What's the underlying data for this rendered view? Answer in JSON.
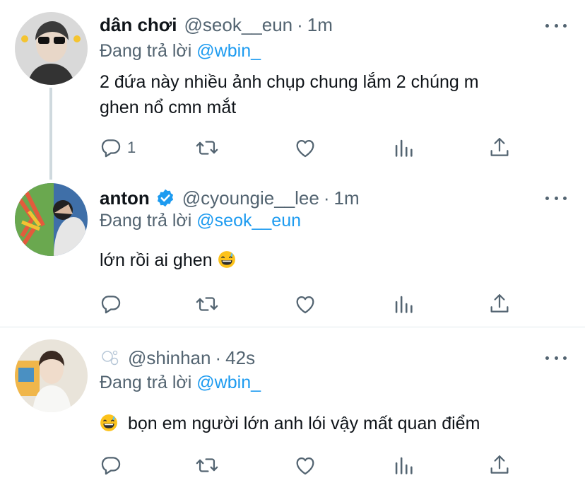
{
  "tweets": [
    {
      "name": "dân chơi",
      "handle": "@seok__eun",
      "time": "1m",
      "reply_prefix": "Đang trả lời",
      "reply_to": "@wbin_",
      "lines": [
        "2 đứa này nhiều ảnh chụp chung lắm 2 chúng m",
        "ghen nổ cmn mắt"
      ],
      "reply_count": "1"
    },
    {
      "name": "anton",
      "verified": true,
      "handle": "@cyoungie__lee",
      "time": "1m",
      "reply_prefix": "Đang trả lời",
      "reply_to": "@seok__eun",
      "text": "lớn rồi ai ghen",
      "emoji": "grinning-sweat-emoji"
    },
    {
      "name_icon": "bubbles-icon",
      "handle": "@shinhan",
      "time": "42s",
      "reply_prefix": "Đang trả lời",
      "reply_to": "@wbin_",
      "leading_emoji": "grinning-sweat-emoji",
      "text": "bọn em người lớn anh lói vậy mất quan điểm"
    }
  ],
  "separator": "·",
  "colors": {
    "link": "#1d9bf0",
    "secondary": "#536471",
    "text": "#0f1419",
    "verified": "#1d9bf0"
  }
}
